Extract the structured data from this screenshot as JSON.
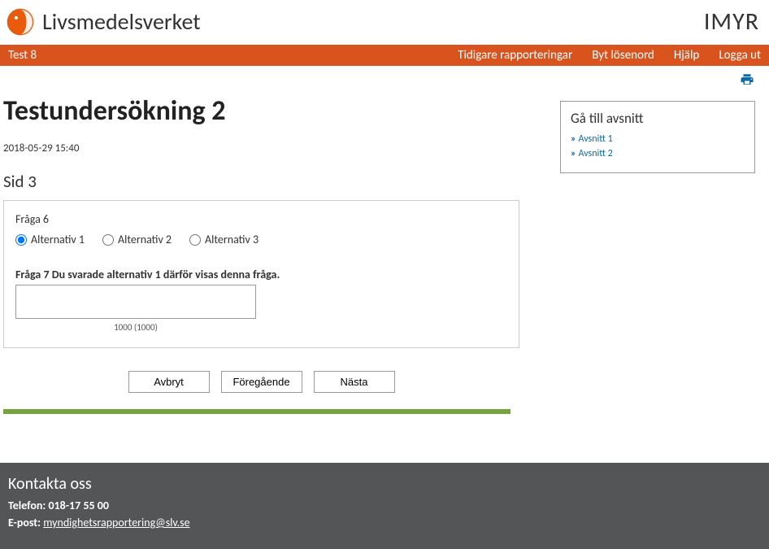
{
  "header": {
    "brand_text": "Livsmedelsverket",
    "app_name": "IMYR"
  },
  "nav": {
    "left": "Test 8",
    "items": [
      "Tidigare rapporteringar",
      "Byt lösenord",
      "Hjälp",
      "Logga ut"
    ]
  },
  "page": {
    "title": "Testundersökning 2",
    "timestamp": "2018-05-29 15:40",
    "page_label": "Sid 3"
  },
  "q6": {
    "label": "Fråga 6",
    "options": [
      "Alternativ 1",
      "Alternativ 2",
      "Alternativ 3"
    ],
    "selected": 0
  },
  "q7": {
    "label": "Fråga 7 Du svarade alternativ 1 därför visas denna fråga.",
    "value": "",
    "counter": "1000 (1000)"
  },
  "buttons": {
    "cancel": "Avbryt",
    "prev": "Föregående",
    "next": "Nästa"
  },
  "sidebar": {
    "title": "Gå till avsnitt",
    "links": [
      "Avsnitt 1",
      "Avsnitt 2"
    ]
  },
  "footer": {
    "title": "Kontakta oss",
    "phone_label": "Telefon:",
    "phone": "018-17 55 00",
    "email_label": "E-post:",
    "email": "myndighetsrapportering@slv.se"
  }
}
